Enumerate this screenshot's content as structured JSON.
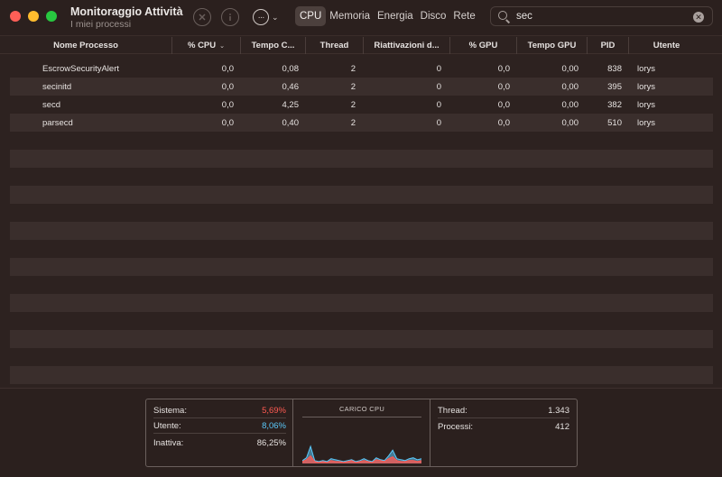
{
  "window": {
    "title": "Monitoraggio Attività",
    "subtitle": "I miei processi"
  },
  "toolbar": {
    "stop_icon": "stop-process-icon",
    "info_icon": "info-icon",
    "more_icon": "more-actions-icon",
    "more_glyph": "···",
    "chevron": "⌄",
    "tabs": [
      "CPU",
      "Memoria",
      "Energia",
      "Disco",
      "Rete"
    ],
    "active_tab": "CPU",
    "search": {
      "value": "sec",
      "clear_glyph": "✕"
    }
  },
  "table": {
    "columns": [
      "Nome Processo",
      "% CPU",
      "Tempo C...",
      "Thread",
      "Riattivazioni d...",
      "% GPU",
      "Tempo GPU",
      "PID",
      "Utente"
    ],
    "sort_glyph": "⌄",
    "rows": [
      [
        "EscrowSecurityAlert",
        "0,0",
        "0,08",
        "2",
        "0",
        "0,0",
        "0,00",
        "838",
        "lorys"
      ],
      [
        "secinitd",
        "0,0",
        "0,46",
        "2",
        "0",
        "0,0",
        "0,00",
        "395",
        "lorys"
      ],
      [
        "secd",
        "0,0",
        "4,25",
        "2",
        "0",
        "0,0",
        "0,00",
        "382",
        "lorys"
      ],
      [
        "parsecd",
        "0,0",
        "0,40",
        "2",
        "0",
        "0,0",
        "0,00",
        "510",
        "lorys"
      ]
    ]
  },
  "footer": {
    "sistema_label": "Sistema:",
    "sistema_value": "5,69%",
    "utente_label": "Utente:",
    "utente_value": "8,06%",
    "inattiva_label": "Inattiva:",
    "inattiva_value": "86,25%",
    "chart_title": "CARICO CPU",
    "thread_label": "Thread:",
    "thread_value": "1.343",
    "processi_label": "Processi:",
    "processi_value": "412"
  },
  "colors": {
    "sistema": "#ff5a52",
    "utente": "#5ac8fa",
    "active_tab_bg": "#4c403d",
    "row_alt": "#3a2e2c"
  },
  "chart_data": {
    "type": "area",
    "title": "CARICO CPU",
    "series": [
      {
        "values": [
          3,
          6,
          18,
          3,
          2,
          3,
          2,
          5,
          4,
          3,
          2,
          3,
          4,
          2,
          3,
          5,
          3,
          2,
          6,
          4,
          3,
          8,
          14,
          5,
          4,
          3,
          5,
          6,
          4,
          5
        ]
      },
      {
        "values": [
          2,
          4,
          8,
          2,
          1,
          2,
          1,
          3,
          2,
          2,
          1,
          2,
          3,
          1,
          2,
          3,
          2,
          1,
          4,
          3,
          2,
          5,
          7,
          3,
          2,
          2,
          3,
          3,
          2,
          3
        ]
      }
    ],
    "ylim": [
      0,
      100
    ]
  }
}
